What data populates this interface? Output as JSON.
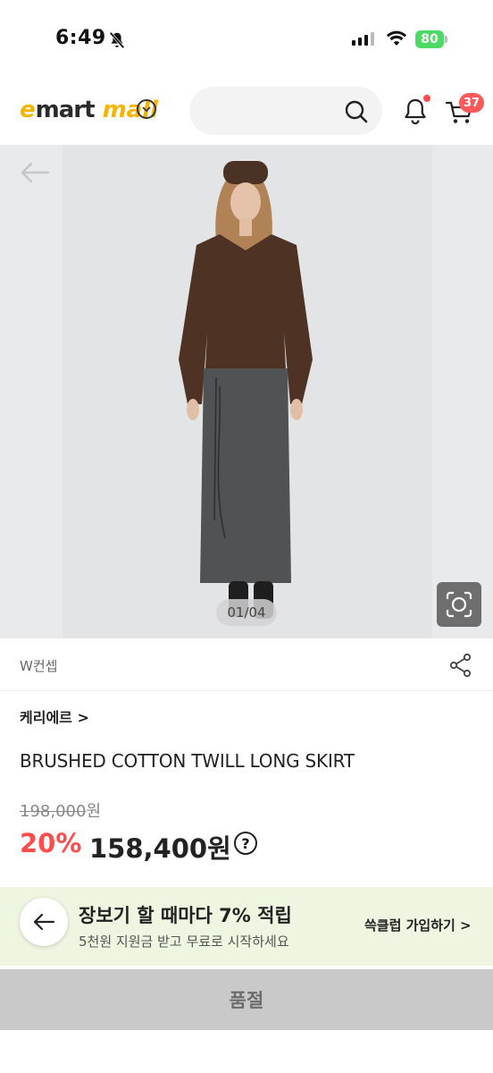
{
  "status_bar": {
    "time": "6:49",
    "battery": "80"
  },
  "header": {
    "logo_e": "e",
    "logo_mart": "mart",
    "logo_mall": "mall",
    "cart_count": "37"
  },
  "gallery": {
    "counter": "01/04"
  },
  "product": {
    "store": "W컨셉",
    "brand_link": "케리에르 >",
    "title": "BRUSHED COTTON TWILL LONG SKIRT",
    "original_price": "198,000",
    "original_unit": "원",
    "discount": "20%",
    "sale_price": "158,400원",
    "help_icon": "?"
  },
  "promo": {
    "title": "장보기 할 때마다 7% 적립",
    "subtitle": "5천원 지원금 받고 무료로 시작하세요",
    "link": "쓱클럽 가입하기 >"
  },
  "bottom_bar": {
    "soldout_label": "품절"
  },
  "colors": {
    "accent": "#ff4d4d",
    "brand_yellow": "#f5b400",
    "promo_bg": "#eef5e0"
  }
}
